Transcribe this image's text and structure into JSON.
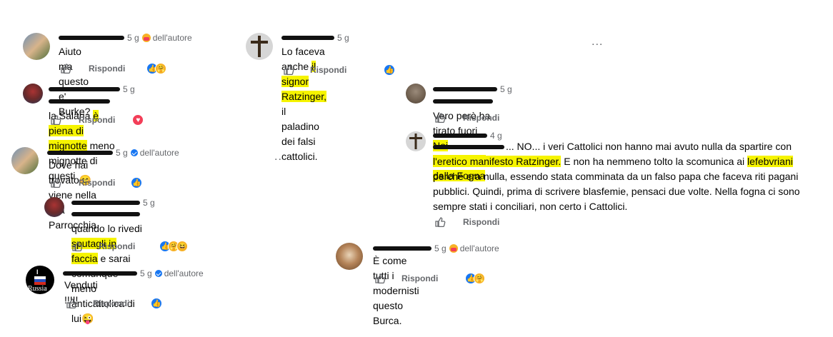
{
  "common": {
    "reply_label": "Rispondi",
    "author_label": "dell'autore",
    "more_label": "..."
  },
  "comments": [
    {
      "time": "5 g",
      "segments": [
        "Aiuto ma questo e' Burke?"
      ]
    },
    {
      "time": "5 g",
      "segments": [
        "Lo faceva anche ",
        "il signor Ratzinger,",
        " il paladino dei falsi cattolici."
      ]
    },
    {
      "time": "5 g",
      "segments": [
        "la Salaria ",
        "è piena di mignotte",
        " meno mignotte di questi"
      ]
    },
    {
      "time": "5 g",
      "segments": [
        "Vero però ha tirato fuori ",
        "Noi Tradizionisti dalla Fogna"
      ]
    },
    {
      "time": "4 g",
      "line1": "... NO... i veri Cattolici non hanno mai avuto nulla da spartire con",
      "line2": [
        "l'eretico manifesto Ratzinger.",
        " E non ha nemmeno tolto la scomunica ai ",
        "lefebvriani"
      ],
      "line3": "perchè era nulla, essendo stata comminata da un falso papa che faceva riti pagani",
      "line4": "pubblici. Quindi, prima di scrivere blasfemie, pensaci due volte. Nella fogna ci sono",
      "line5": "sempre stati i conciliari, non certo i Cattolici."
    },
    {
      "time": "5 g",
      "segments": [
        "Dove hai trovato",
        "viene nella mia Parrocchia"
      ]
    },
    {
      "time": "5 g",
      "line1": [
        "quando lo rivedi ",
        "sputagli in faccia",
        " e sarai comunque meno"
      ],
      "line2": "anticattolica di lui"
    },
    {
      "time": "5 g",
      "segments": [
        "È come tutti i modernisti questo Burca."
      ]
    },
    {
      "time": "5 g",
      "segments": [
        "Venduti !!!!!"
      ],
      "avatar_text": "Russia"
    }
  ]
}
